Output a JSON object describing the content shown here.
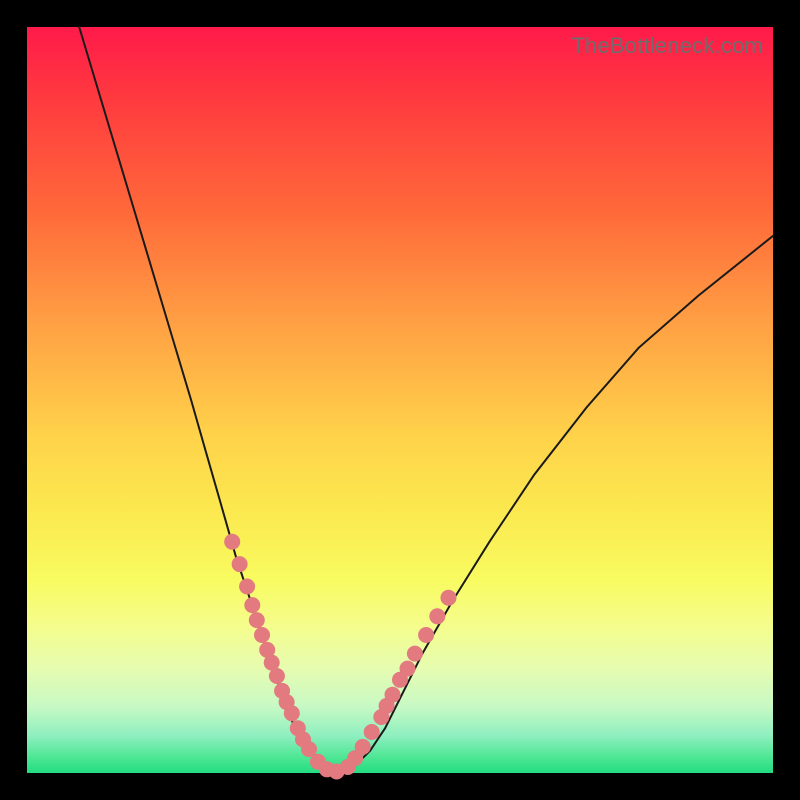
{
  "watermark": "TheBottleneck.com",
  "colors": {
    "page_bg": "#000000",
    "watermark": "#6d6d6d",
    "curve": "#1a1a1a",
    "dot": "#e27a7f",
    "gradient_top": "#ff1a4a",
    "gradient_bottom": "#23dc82"
  },
  "chart_data": {
    "type": "line",
    "title": "",
    "xlabel": "",
    "ylabel": "",
    "xlim": [
      0,
      100
    ],
    "ylim": [
      0,
      100
    ],
    "grid": false,
    "legend": "none",
    "series": [
      {
        "name": "curve",
        "x": [
          7,
          10,
          13,
          16,
          19,
          22,
          24,
          26,
          28,
          30,
          31,
          32,
          33,
          34,
          35,
          36,
          37,
          38,
          40,
          41,
          42,
          44,
          46,
          48,
          50,
          53,
          57,
          62,
          68,
          75,
          82,
          90,
          100
        ],
        "y": [
          100,
          90,
          80,
          70,
          60,
          50,
          43,
          36,
          29,
          23,
          20,
          17,
          14,
          11,
          8,
          6,
          4,
          3,
          1,
          0,
          0,
          1,
          3,
          6,
          10,
          16,
          23,
          31,
          40,
          49,
          57,
          64,
          72
        ]
      }
    ],
    "markers": {
      "name": "dots",
      "x": [
        27.5,
        28.5,
        29.5,
        30.2,
        30.8,
        31.5,
        32.2,
        32.8,
        33.5,
        34.2,
        34.8,
        35.5,
        36.3,
        37.0,
        37.8,
        39.0,
        40.2,
        41.5,
        43.0,
        44.0,
        45.0,
        46.2,
        47.5,
        48.2,
        49.0,
        50.0,
        51.0,
        52.0,
        53.5,
        55.0,
        56.5
      ],
      "y": [
        31.0,
        28.0,
        25.0,
        22.5,
        20.5,
        18.5,
        16.5,
        14.8,
        13.0,
        11.0,
        9.5,
        8.0,
        6.0,
        4.5,
        3.2,
        1.5,
        0.5,
        0.2,
        0.8,
        2.0,
        3.5,
        5.5,
        7.5,
        9.0,
        10.5,
        12.5,
        14.0,
        16.0,
        18.5,
        21.0,
        23.5
      ]
    }
  }
}
